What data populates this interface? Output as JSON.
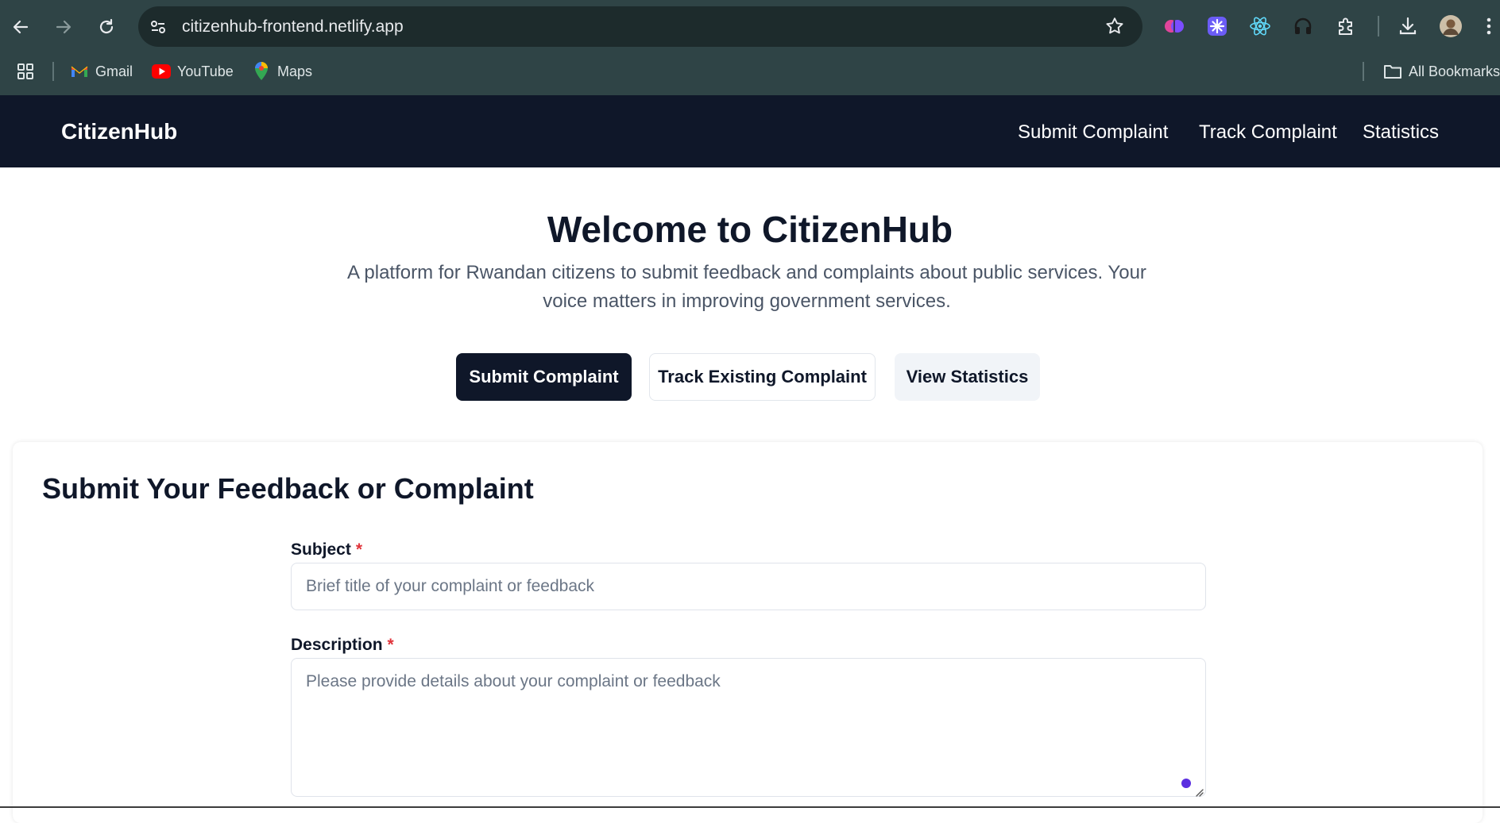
{
  "browser": {
    "url": "citizenhub-frontend.netlify.app",
    "bookmarks": [
      {
        "label": "Gmail",
        "icon": "gmail-icon"
      },
      {
        "label": "YouTube",
        "icon": "youtube-icon"
      },
      {
        "label": "Maps",
        "icon": "maps-icon"
      }
    ],
    "all_bookmarks_label": "All Bookmarks"
  },
  "app": {
    "brand": "CitizenHub",
    "nav": [
      {
        "label": "Submit Complaint"
      },
      {
        "label": "Track Complaint"
      },
      {
        "label": "Statistics"
      }
    ]
  },
  "hero": {
    "title": "Welcome to CitizenHub",
    "subtitle": "A platform for Rwandan citizens to submit feedback and complaints about public services. Your voice matters in improving government services.",
    "buttons": {
      "primary": "Submit Complaint",
      "outline": "Track Existing Complaint",
      "ghost": "View Statistics"
    }
  },
  "form": {
    "title": "Submit Your Feedback or Complaint",
    "subject": {
      "label": "Subject",
      "required_mark": "*",
      "placeholder": "Brief title of your complaint or feedback"
    },
    "description": {
      "label": "Description",
      "required_mark": "*",
      "placeholder": "Please provide details about your complaint or feedback"
    }
  },
  "colors": {
    "chrome": "#2f4446",
    "header": "#0f1729",
    "primary": "#0f1729",
    "required": "#e0343b"
  }
}
